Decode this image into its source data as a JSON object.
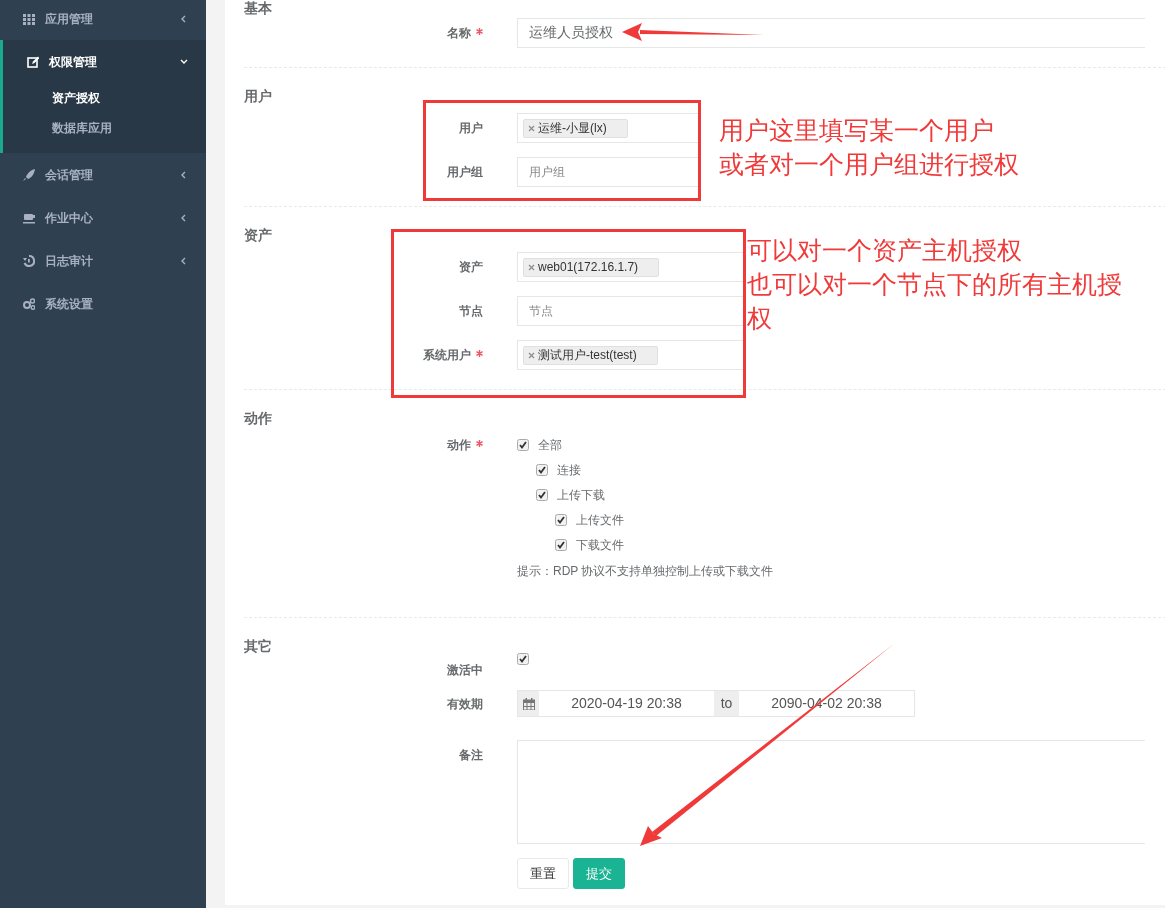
{
  "sidebar": {
    "items": [
      {
        "label": "应用管理",
        "kind": "menu",
        "expanded": false
      },
      {
        "label": "权限管理",
        "kind": "menu",
        "expanded": true,
        "children": [
          {
            "label": "资产授权",
            "selected": true
          },
          {
            "label": "数据库应用",
            "selected": false
          }
        ]
      },
      {
        "label": "会话管理",
        "kind": "menu",
        "expanded": false
      },
      {
        "label": "作业中心",
        "kind": "menu",
        "expanded": false
      },
      {
        "label": "日志审计",
        "kind": "menu",
        "expanded": false
      },
      {
        "label": "系统设置",
        "kind": "link",
        "expanded": false
      }
    ]
  },
  "form": {
    "sections": [
      {
        "title": "基本",
        "fields": [
          {
            "label": "名称",
            "required": true,
            "kind": "text",
            "value": "运维人员授权"
          }
        ]
      },
      {
        "title": "用户",
        "fields": [
          {
            "label": "用户",
            "required": false,
            "kind": "tags",
            "tags": [
              "运维-小显(lx)"
            ]
          },
          {
            "label": "用户组",
            "required": false,
            "kind": "text",
            "placeholder": "用户组"
          }
        ]
      },
      {
        "title": "资产",
        "fields": [
          {
            "label": "资产",
            "required": false,
            "kind": "tags",
            "tags": [
              "web01(172.16.1.7)"
            ]
          },
          {
            "label": "节点",
            "required": false,
            "kind": "text",
            "placeholder": "节点"
          },
          {
            "label": "系统用户",
            "required": true,
            "kind": "tags",
            "tags": [
              "测试用户-test(test)"
            ]
          }
        ]
      },
      {
        "title": "动作",
        "fields": [
          {
            "label": "动作",
            "required": true,
            "kind": "checklist",
            "hint": "提示：RDP 协议不支持单独控制上传或下载文件",
            "options": [
              {
                "label": "全部",
                "checked": true,
                "children": [
                  {
                    "label": "连接",
                    "checked": true
                  },
                  {
                    "label": "上传下载",
                    "checked": true,
                    "children": [
                      {
                        "label": "上传文件",
                        "checked": true
                      },
                      {
                        "label": "下载文件",
                        "checked": true
                      }
                    ]
                  }
                ]
              }
            ]
          }
        ]
      },
      {
        "title": "其它",
        "fields": [
          {
            "label": "激活中",
            "required": false,
            "kind": "checkbox",
            "checked": true
          },
          {
            "label": "有效期",
            "required": false,
            "kind": "daterange",
            "start": "2020-04-19 20:38",
            "separator": "to",
            "end": "2090-04-02 20:38"
          },
          {
            "label": "备注",
            "required": false,
            "kind": "textarea"
          }
        ]
      }
    ],
    "buttons": [
      {
        "label": "重置",
        "kind": "default"
      },
      {
        "label": "提交",
        "kind": "primary"
      }
    ]
  },
  "annotations": [
    {
      "kind": "arrow"
    },
    {
      "kind": "box"
    },
    {
      "kind": "note",
      "lines": [
        "用户这里填写某一个用户",
        "或者对一个用户组进行授权"
      ]
    },
    {
      "kind": "box"
    },
    {
      "kind": "note",
      "lines": [
        "可以对一个资产主机授权",
        "也可以对一个节点下的所有主机授",
        "权"
      ]
    },
    {
      "kind": "arrow"
    }
  ]
}
